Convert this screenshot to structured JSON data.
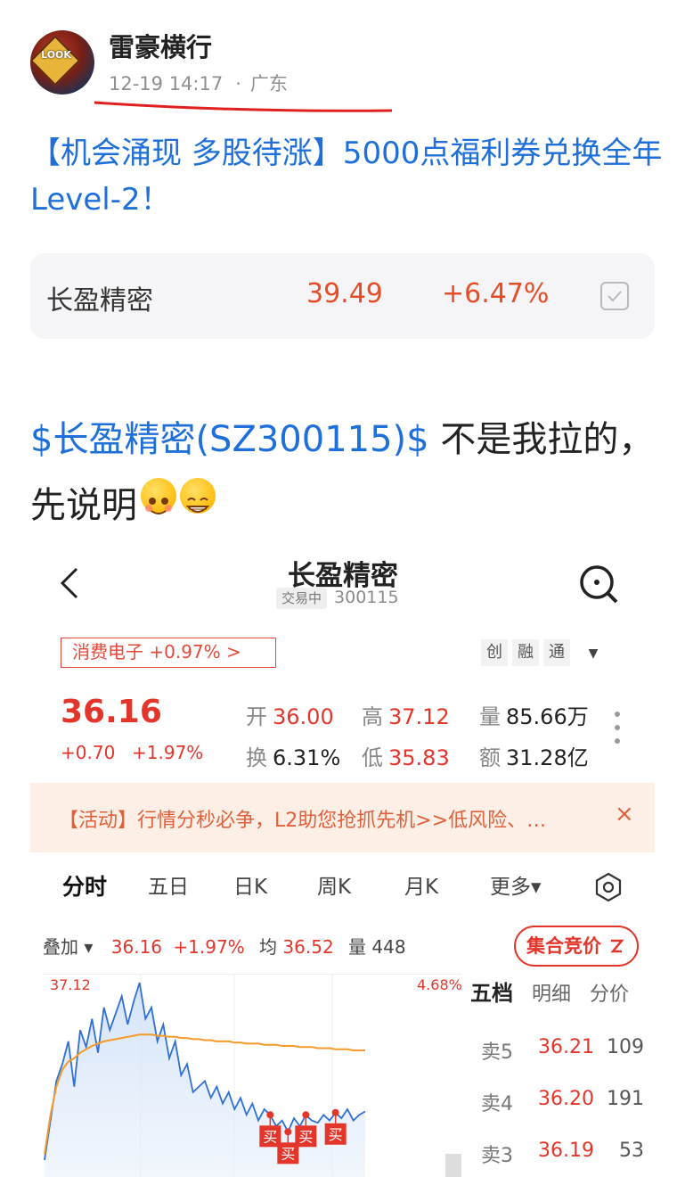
{
  "post": {
    "author": "雷豪横行",
    "avatar_text": "LOOK",
    "time": "12-19 14:17",
    "location": "广东",
    "title": "【机会涌现 多股待涨】5000点福利券兑换全年Level-2！",
    "stock_card": {
      "name": "长盈精密",
      "price": "39.49",
      "change_pct": "+6.47%"
    },
    "body_link": "$长盈精密(SZ300115)$",
    "body_text": " 不是我拉的，先说明"
  },
  "embedded": {
    "title": "长盈精密",
    "status_tag": "交易中",
    "code": "300115",
    "sector": "消费电子 +0.97% >",
    "flags": [
      "创",
      "融",
      "通"
    ],
    "flags_more": "▼",
    "price": "36.16",
    "change": "+0.70",
    "change_pct": "+1.97%",
    "quotes": [
      {
        "label": "开",
        "value": "36.00",
        "color": "red"
      },
      {
        "label": "高",
        "value": "37.12",
        "color": "red"
      },
      {
        "label": "量",
        "value": "85.66万",
        "color": "plain"
      },
      {
        "label": "换",
        "value": "6.31%",
        "color": "plain"
      },
      {
        "label": "低",
        "value": "35.83",
        "color": "red"
      },
      {
        "label": "额",
        "value": "31.28亿",
        "color": "plain"
      }
    ],
    "notice": "【活动】行情分秒必争，L2助您抢抓先机>>低风险、…",
    "notice_close": "×",
    "tabs": [
      "分时",
      "五日",
      "日K",
      "周K",
      "月K",
      "更多▾"
    ],
    "overlay": {
      "label": "叠加 ▾",
      "price": "36.16",
      "pct": "+1.97%",
      "avg_label": "均",
      "avg": "36.52",
      "vol_label": "量",
      "vol": "448"
    },
    "auction_button": "集合竞价",
    "chart_labels": {
      "high": "37.12",
      "pct_high": "4.68%",
      "buy_marker": "买"
    },
    "orderbook": {
      "headers": [
        "五档",
        "明细",
        "分价"
      ],
      "rows": [
        {
          "side": "卖5",
          "price": "36.21",
          "vol": "109"
        },
        {
          "side": "卖4",
          "price": "36.20",
          "vol": "191"
        },
        {
          "side": "卖3",
          "price": "36.19",
          "vol": "53"
        }
      ]
    }
  },
  "chart_data": {
    "type": "line",
    "title": "",
    "xlabel": "",
    "ylabel": "",
    "ylim": [
      35.4,
      37.12
    ],
    "series": [
      {
        "name": "",
        "values": [
          35.55,
          35.9,
          36.25,
          36.4,
          36.6,
          36.2,
          36.7,
          36.55,
          36.8,
          36.5,
          36.9,
          36.7,
          36.85,
          37.0,
          36.75,
          36.95,
          37.12,
          36.8,
          36.9,
          36.6,
          36.75,
          36.45,
          36.6,
          36.3,
          36.4,
          36.15,
          36.2,
          36.25,
          36.1,
          36.2,
          36.05,
          36.15,
          36.0,
          36.1,
          35.95,
          36.05,
          35.9,
          36.0,
          35.95,
          35.85,
          35.9,
          35.8,
          35.92,
          35.85,
          35.95,
          35.9,
          35.88,
          35.95,
          35.9,
          35.97,
          35.92,
          36.0,
          35.9,
          35.95,
          35.98
        ]
      },
      {
        "name": "",
        "values": [
          35.6,
          35.95,
          36.2,
          36.35,
          36.42,
          36.45,
          36.5,
          36.53,
          36.56,
          36.58,
          36.6,
          36.61,
          36.62,
          36.63,
          36.64,
          36.65,
          36.66,
          36.66,
          36.66,
          36.65,
          36.65,
          36.64,
          36.64,
          36.63,
          36.63,
          36.62,
          36.62,
          36.61,
          36.61,
          36.6,
          36.6,
          36.6,
          36.59,
          36.59,
          36.58,
          36.58,
          36.58,
          36.57,
          36.57,
          36.57,
          36.56,
          36.56,
          36.56,
          36.55,
          36.55,
          36.55,
          36.54,
          36.54,
          36.54,
          36.53,
          36.53,
          36.53,
          36.52,
          36.52,
          36.52
        ]
      }
    ],
    "markers": [
      {
        "index": 38,
        "label": "买"
      },
      {
        "index": 41,
        "label": "买"
      },
      {
        "index": 44,
        "label": "买"
      },
      {
        "index": 49,
        "label": "买"
      }
    ]
  }
}
